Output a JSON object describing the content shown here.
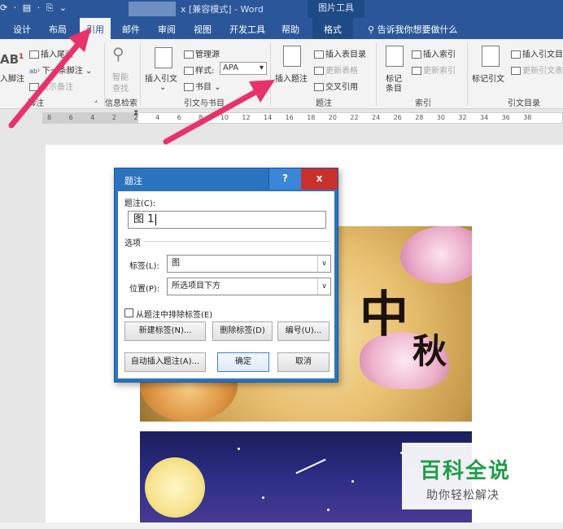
{
  "titlebar": {
    "qat": "⟳ · ▤ · ⎘ ⌄",
    "doc_suffix": "x [兼容模式]  -  Word",
    "context_group": "图片工具"
  },
  "tabs": {
    "design": "设计",
    "layout": "布局",
    "references": "引用",
    "mailings": "邮件",
    "review": "审阅",
    "view": "视图",
    "developer": "开发工具",
    "help": "帮助",
    "format": "格式",
    "tell_me": "告诉我你想要做什么"
  },
  "ribbon": {
    "footnote": {
      "ab": "AB",
      "ab_sup": "1",
      "insert_footnote": "入脚注",
      "insert_endnote": "插入尾注",
      "next_footnote": "下一条脚注",
      "show_notes": "显示备注",
      "group": "脚注"
    },
    "research": {
      "smart_lookup_1": "智能",
      "smart_lookup_2": "查找",
      "group": "信息检索"
    },
    "citations": {
      "insert_citation": "插入引文",
      "manage_sources": "管理源",
      "style_label": "样式:",
      "style_value": "APA",
      "bibliography": "书目",
      "group": "引文与书目"
    },
    "captions": {
      "insert_caption": "插入题注",
      "insert_table_of_figures": "插入表目录",
      "update_table": "更新表格",
      "cross_reference": "交叉引用",
      "group": "题注"
    },
    "index": {
      "mark_entry_1": "标记",
      "mark_entry_2": "条目",
      "insert_index": "插入索引",
      "update_index": "更新索引",
      "group": "索引"
    },
    "toa": {
      "mark_citation": "标记引文",
      "insert_toa": "插入引文目",
      "update_toa": "更新引文表",
      "group": "引文目录"
    }
  },
  "ruler": {
    "ticks": [
      "8",
      "6",
      "4",
      "2",
      "2",
      "4",
      "6",
      "8",
      "10",
      "12",
      "14",
      "16",
      "18",
      "20",
      "22",
      "24",
      "26",
      "28",
      "30",
      "32",
      "34",
      "36",
      "38"
    ]
  },
  "dialog": {
    "title": "题注",
    "help": "?",
    "close": "x",
    "caption_label": "题注(C):",
    "caption_value": "图  1",
    "options_label": "选项",
    "label_label": "标签(L):",
    "label_value": "图",
    "position_label": "位置(P):",
    "position_value": "所选项目下方",
    "exclude_label": "从题注中排除标签(E)",
    "new_label": "新建标签(N)...",
    "delete_label": "删除标签(D)",
    "numbering": "编号(U)...",
    "autocaption": "自动插入题注(A)...",
    "ok": "确定",
    "cancel": "取消"
  },
  "image": {
    "calligraphy_1": "中",
    "calligraphy_2": "秋"
  },
  "watermark": {
    "main": "百科全说",
    "sub": "助你轻松解决"
  },
  "colors": {
    "accent": "#2b579a",
    "arrow": "#e8336a",
    "watermark_green": "#1e9e48",
    "close_red": "#c9302c"
  }
}
